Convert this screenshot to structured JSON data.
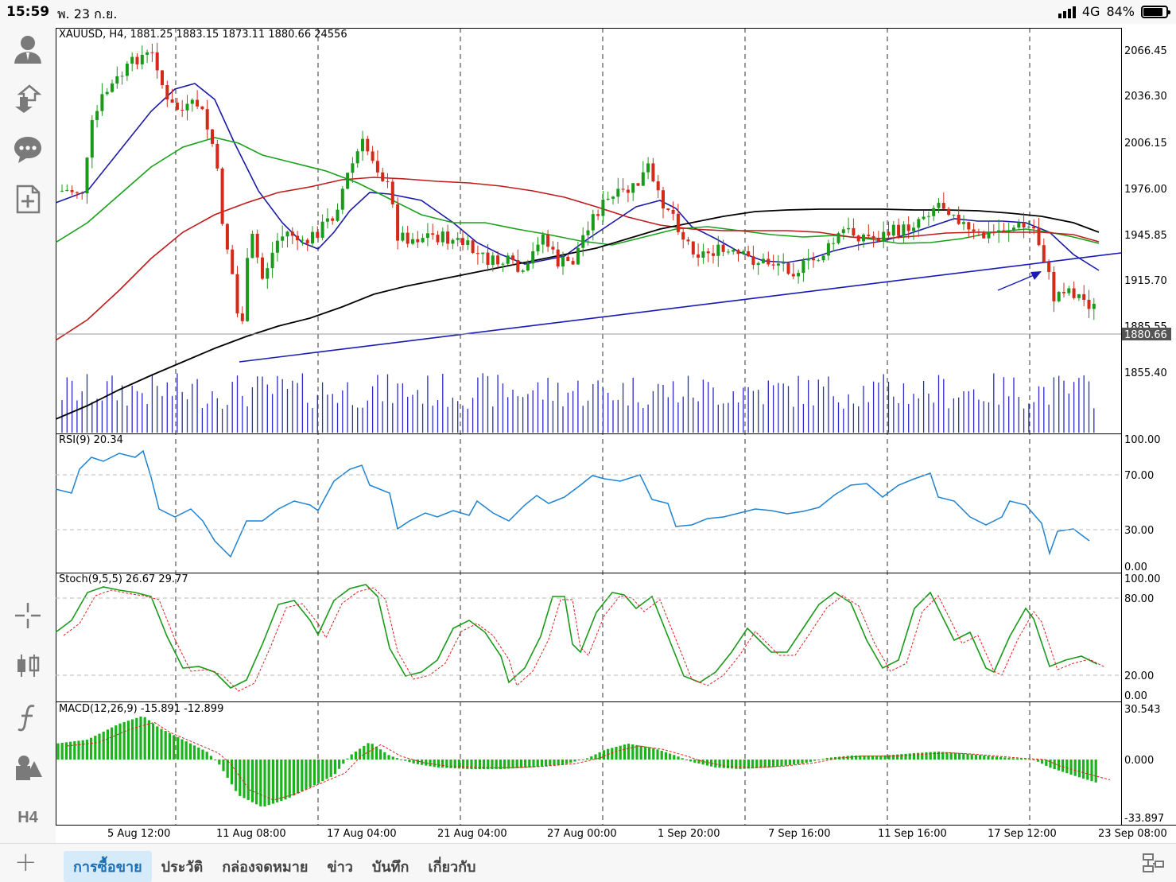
{
  "status_bar": {
    "time": "15:59",
    "date": "พ. 23 ก.ย.",
    "network": "4G",
    "battery": "84%",
    "battery_level": 0.84
  },
  "left_toolbar": {
    "items": [
      "account-icon",
      "download-icon",
      "chat-icon",
      "new-order-icon"
    ],
    "bottom_items": [
      "crosshair-icon",
      "candles-icon",
      "indicators-icon",
      "objects-icon",
      "timeframe"
    ],
    "timeframe_label": "H4"
  },
  "chart": {
    "header": "XAUUSD, H4, 1881.25 1883.15 1873.11 1880.66 24556",
    "current_price_label": "1880.66",
    "price_ticks": [
      "2066.45",
      "2036.30",
      "2006.15",
      "1976.00",
      "1945.85",
      "1915.70",
      "1885.55",
      "1855.40"
    ],
    "time_labels": [
      "5 Aug 12:00",
      "11 Aug 08:00",
      "17 Aug 04:00",
      "21 Aug 04:00",
      "27 Aug 00:00",
      "1 Sep 20:00",
      "7 Sep 16:00",
      "11 Sep 16:00",
      "17 Sep 12:00",
      "23 Sep 08:00"
    ],
    "rsi": {
      "label": "RSI(9) 20.34",
      "ticks": [
        "100.00",
        "70.00",
        "30.00",
        "0.00"
      ]
    },
    "stoch": {
      "label": "Stoch(9,5,5) 26.67 29.77",
      "ticks": [
        "100.00",
        "80.00",
        "20.00",
        "0.00"
      ]
    },
    "macd": {
      "label": "MACD(12,26,9) -15.891 -12.899",
      "ticks": [
        "30.543",
        "0.000",
        "-33.897"
      ]
    },
    "colors": {
      "bull": "#1a9a1a",
      "bear": "#d42a1a",
      "ma_fast": "#1a1aaa",
      "ma_mid": "#1aa01a",
      "ma_slow": "#c01a1a",
      "ma_long": "#000000",
      "trendline": "#1a1ab4",
      "rsi_line": "#1e82d2",
      "volume": "#2a2ac8",
      "macd_hist": "#1ab41a",
      "signal": "#e02020"
    }
  },
  "tab_bar": {
    "tabs": [
      "การซื้อขาย",
      "ประวัติ",
      "กล่องจดหมาย",
      "ข่าว",
      "บันทึก",
      "เกี่ยวกับ"
    ],
    "active_index": 0
  }
}
